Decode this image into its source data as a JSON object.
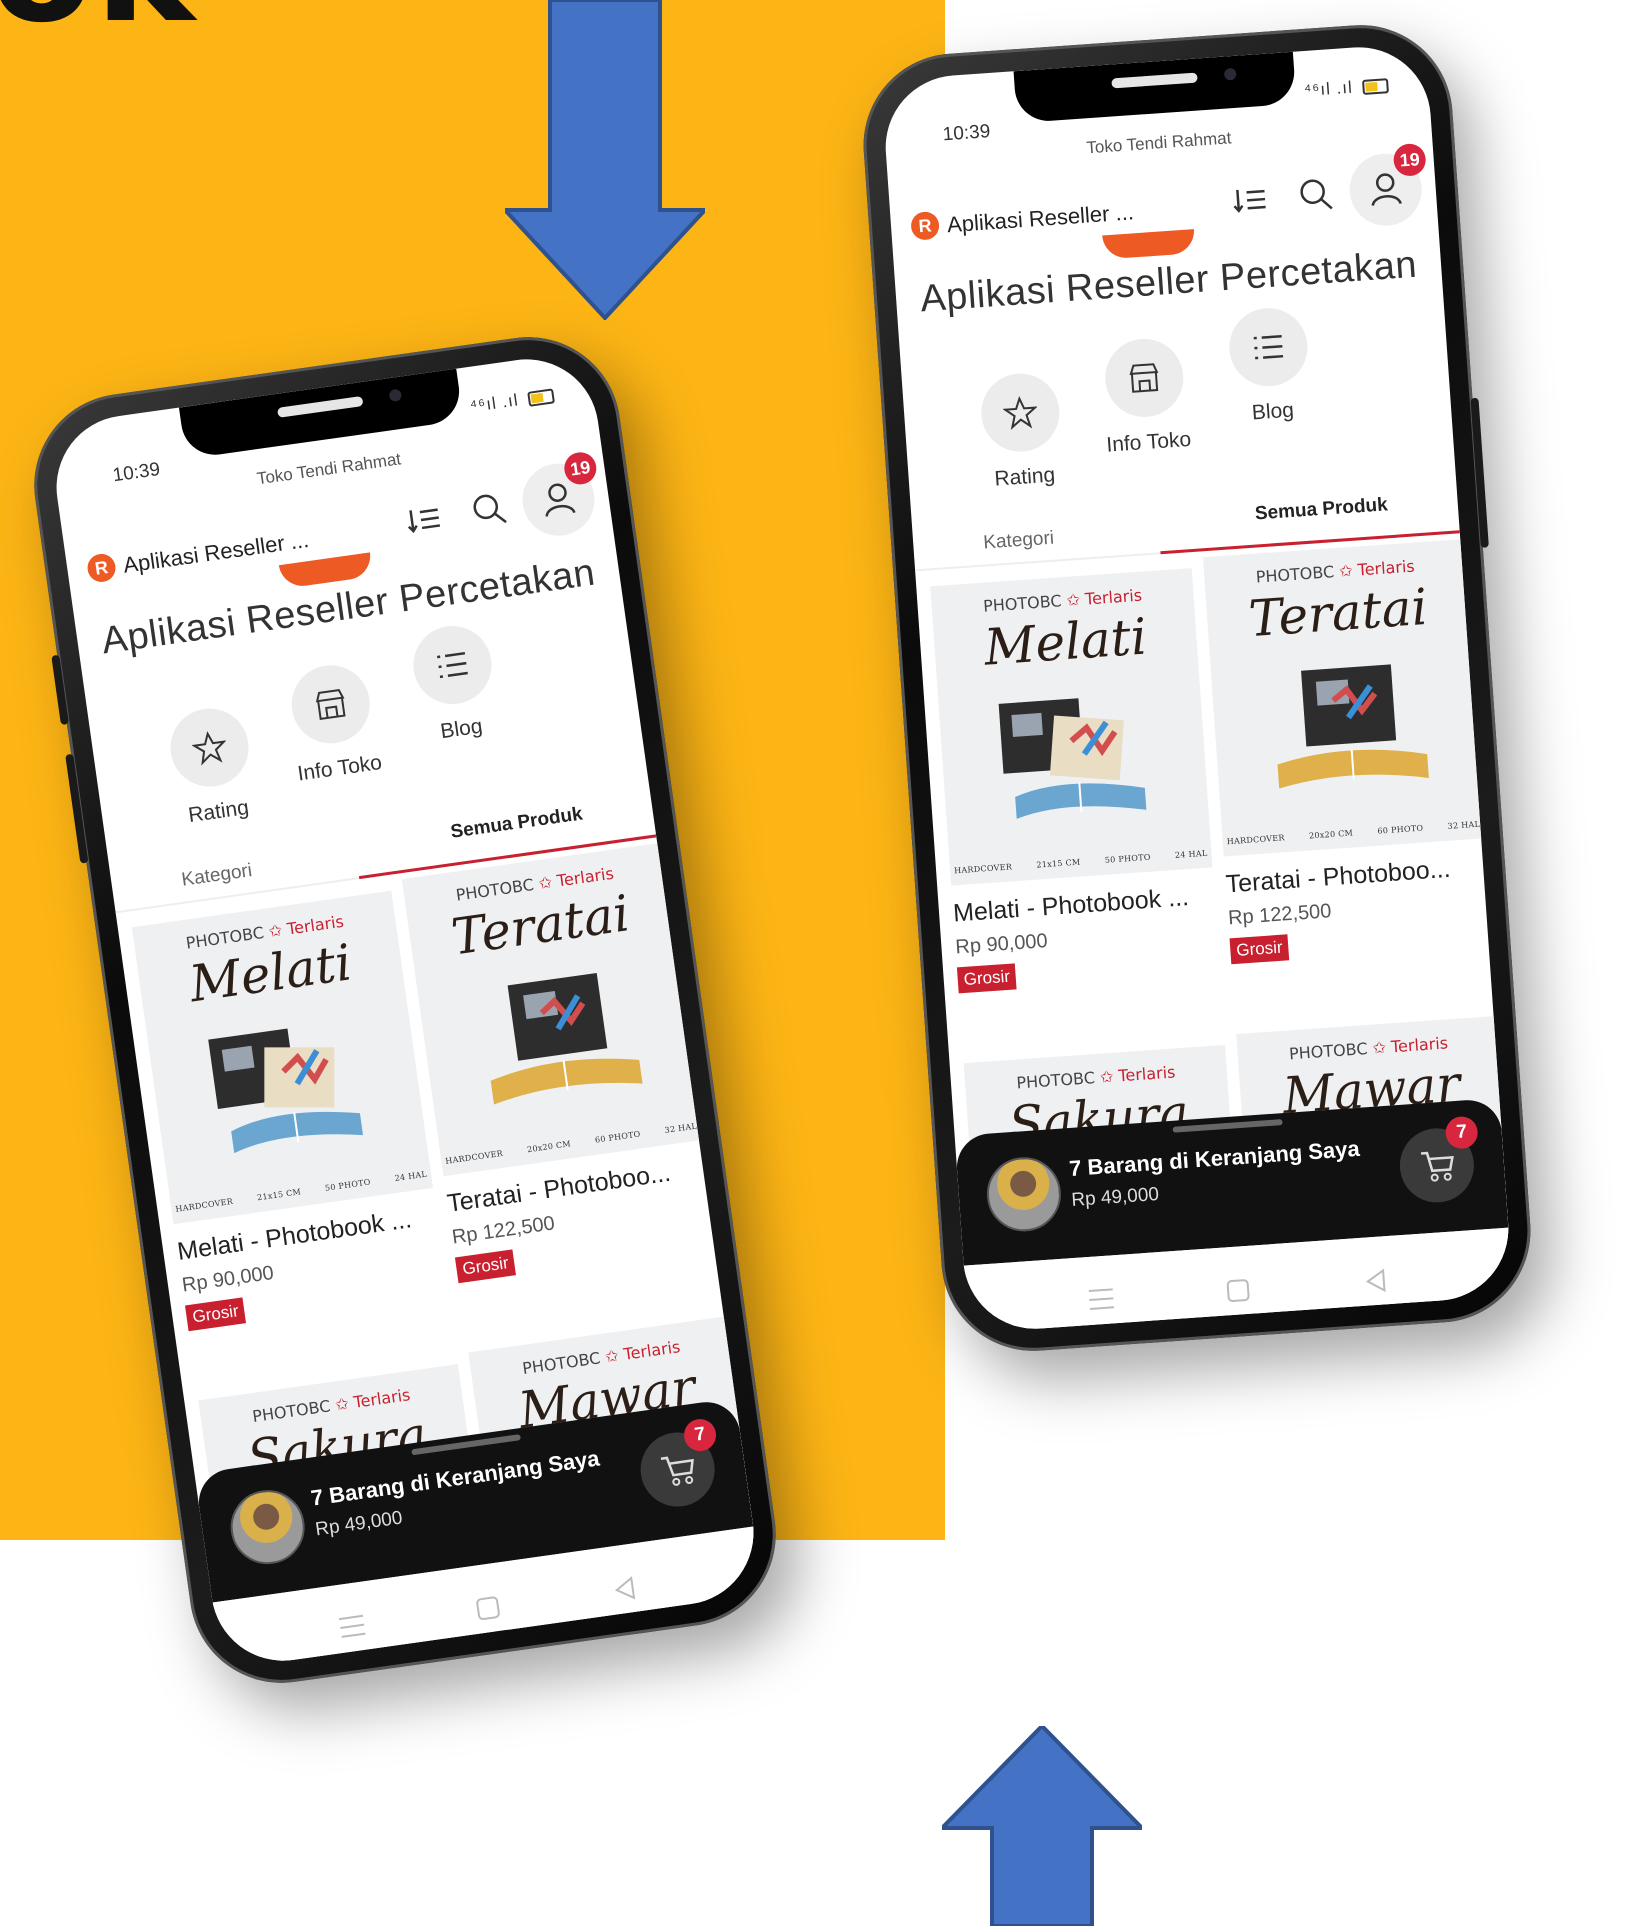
{
  "heading_fragment": "ok",
  "colors": {
    "panel_yellow": "#fdb515",
    "arrow_blue": "#4472c4",
    "accent_red": "#c8202f",
    "brand_orange": "#ee5a24",
    "badge_red": "#d7263d"
  },
  "status_bar": {
    "time": "10:39",
    "icons": [
      "whatsapp-icon",
      "signal-icon",
      "battery-icon"
    ],
    "signal_text": "⁴⁶ıl .ıl"
  },
  "store_name": "Toko Tendi Rahmat",
  "app_bar": {
    "logo_letter": "R",
    "title": "Aplikasi Reseller ...",
    "account_badge": "19"
  },
  "store_title": "Aplikasi Reseller Percetakan",
  "quick_menu": [
    {
      "label": "Rating",
      "icon": "star-icon"
    },
    {
      "label": "Info Toko",
      "icon": "store-icon"
    },
    {
      "label": "Blog",
      "icon": "list-icon"
    }
  ],
  "tabs": {
    "category": "Kategori",
    "all_products": "Semua Produk",
    "active": "Semua Produk"
  },
  "products": [
    {
      "brand": "PHOTOBC",
      "tag": "✩ Terlaris",
      "script_name": "Melati",
      "specs": [
        "HARDCOVER",
        "21x15 CM",
        "50 PHOTO",
        "24 HAL"
      ],
      "name": "Melati - Photobook ...",
      "price": "Rp 90,000",
      "badge": "Grosir"
    },
    {
      "brand": "PHOTOBC",
      "tag": "✩ Terlaris",
      "script_name": "Teratai",
      "specs": [
        "HARDCOVER",
        "20x20 CM",
        "60 PHOTO",
        "32 HAL"
      ],
      "name": "Teratai - Photoboo...",
      "price": "Rp 122,500",
      "badge": "Grosir"
    },
    {
      "brand": "PHOTOBC",
      "tag": "✩ Terlaris",
      "script_name": "Sakura"
    },
    {
      "brand": "PHOTOBC",
      "tag": "✩ Terlaris",
      "script_name": "Mawar"
    }
  ],
  "cart": {
    "title": "7 Barang di Keranjang Saya",
    "price": "Rp 49,000",
    "count": "7"
  },
  "nav": [
    "menu-icon",
    "home-square-icon",
    "back-triangle-icon"
  ]
}
